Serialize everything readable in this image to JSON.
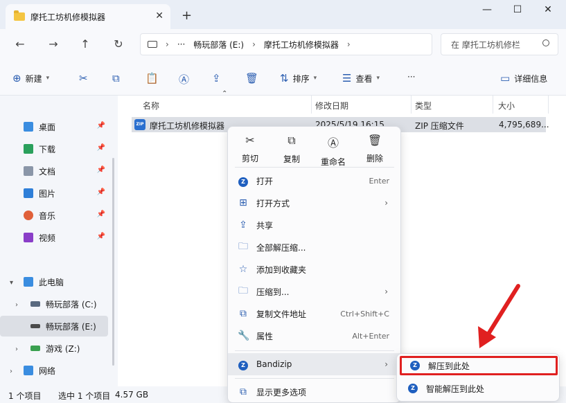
{
  "window": {
    "tab_title": "摩托工坊机修模拟器",
    "tab_close": "✕",
    "new_tab": "+",
    "controls": [
      "—",
      "☐",
      "✕"
    ]
  },
  "nav": {
    "back": "←",
    "forward": "→",
    "up": "↑",
    "refresh": "↻",
    "breadcrumb_more": "···",
    "breadcrumbs": [
      "畅玩部落 (E:)",
      "摩托工坊机修模拟器"
    ],
    "search_placeholder": "在 摩托工坊机修栏"
  },
  "toolbar": {
    "new_label": "新建",
    "sort_label": "排序",
    "view_label": "查看",
    "more": "···",
    "details_label": "详细信息"
  },
  "sidebar": {
    "quick": [
      "桌面",
      "下载",
      "文档",
      "图片",
      "音乐",
      "视频"
    ],
    "this_pc": "此电脑",
    "drives": [
      "畅玩部落 (C:)",
      "畅玩部落 (E:)",
      "游戏 (Z:)"
    ],
    "network": "网络"
  },
  "columns": [
    "名称",
    "修改日期",
    "类型",
    "大小"
  ],
  "file": {
    "icon_text": "ZIP",
    "name": "摩托工坊机修模拟器",
    "date": "2025/5/19 16:15",
    "type": "ZIP 压缩文件",
    "size": "4,795,689..."
  },
  "status": {
    "count": "1 个项目",
    "selected": "选中 1 个项目",
    "size": "4.57 GB"
  },
  "context_menu": {
    "quick_actions": [
      "剪切",
      "复制",
      "重命名",
      "删除"
    ],
    "items": [
      {
        "label": "打开",
        "hint": "Enter"
      },
      {
        "label": "打开方式"
      },
      {
        "label": "共享"
      },
      {
        "label": "全部解压缩..."
      },
      {
        "label": "添加到收藏夹"
      },
      {
        "label": "压缩到..."
      },
      {
        "label": "复制文件地址",
        "hint": "Ctrl+Shift+C"
      },
      {
        "label": "属性",
        "hint": "Alt+Enter"
      },
      {
        "label": "Bandizip"
      },
      {
        "label": "显示更多选项"
      }
    ]
  },
  "submenu": {
    "items": [
      "解压到此处",
      "智能解压到此处"
    ]
  },
  "colors": {
    "highlight_box": "#e02020",
    "accent": "#2a5db0"
  }
}
